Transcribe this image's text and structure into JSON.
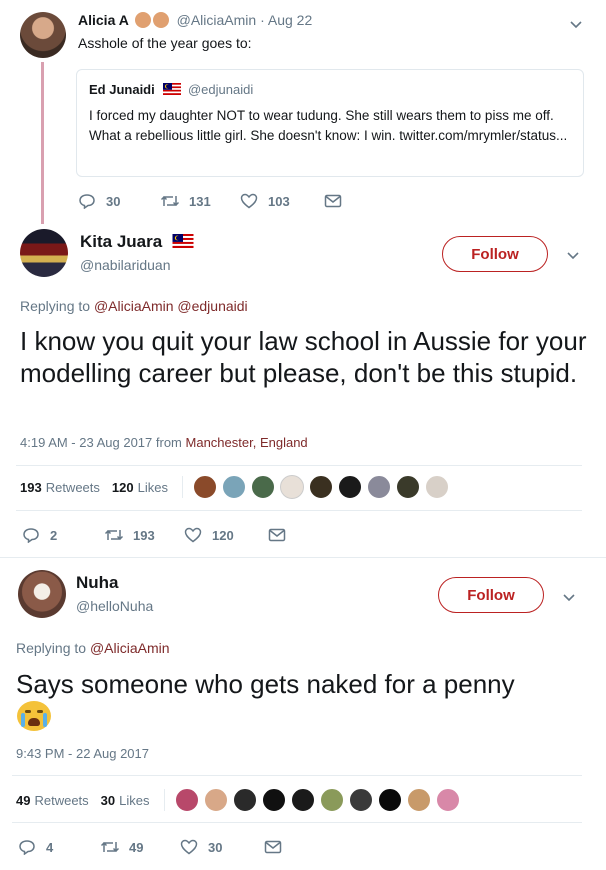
{
  "tweet1": {
    "name": "Alicia A",
    "handle": "@AliciaAmin",
    "date": "· Aug 22",
    "text": "Asshole of the year goes to:",
    "quote": {
      "name": "Ed Junaidi",
      "handle": "@edjunaidi",
      "text": "I forced my daughter NOT to wear tudung. She still wears them to piss me off. What a rebellious little girl. She doesn't know: I win. twitter.com/mrymler/status..."
    },
    "actions": {
      "replies": "30",
      "retweets": "131",
      "likes": "103"
    }
  },
  "tweet2": {
    "name": "Kita Juara",
    "handle": "@nabilariduan",
    "follow_label": "Follow",
    "replying_prefix": "Replying to",
    "replying_to": "@AliciaAmin @edjunaidi",
    "text": "I know you quit your law school in Aussie for your modelling career but please, don't be this stupid.",
    "timestamp": "4:19 AM - 23 Aug 2017 from",
    "location": "Manchester, England",
    "retweet_count": "193",
    "retweet_label": "Retweets",
    "like_count": "120",
    "like_label": "Likes",
    "actions": {
      "replies": "2",
      "retweets": "193",
      "likes": "120"
    }
  },
  "tweet3": {
    "name": "Nuha",
    "handle": "@helloNuha",
    "follow_label": "Follow",
    "replying_prefix": "Replying to",
    "replying_to": "@AliciaAmin",
    "text": "Says someone who gets naked for a penny",
    "emoji": "😭",
    "timestamp": "9:43 PM - 22 Aug 2017",
    "retweet_count": "49",
    "retweet_label": "Retweets",
    "like_count": "30",
    "like_label": "Likes",
    "actions": {
      "replies": "4",
      "retweets": "49",
      "likes": "30"
    }
  },
  "colors": {
    "accent": "#b22222",
    "link": "#7e2a2a",
    "muted": "#657786",
    "divider": "#e6ecf0"
  },
  "icons": [
    "reply-icon",
    "retweet-icon",
    "like-icon",
    "dm-icon",
    "chevron-down-icon",
    "malaysia-flag-icon",
    "clap-emoji",
    "crying-face-emoji"
  ]
}
